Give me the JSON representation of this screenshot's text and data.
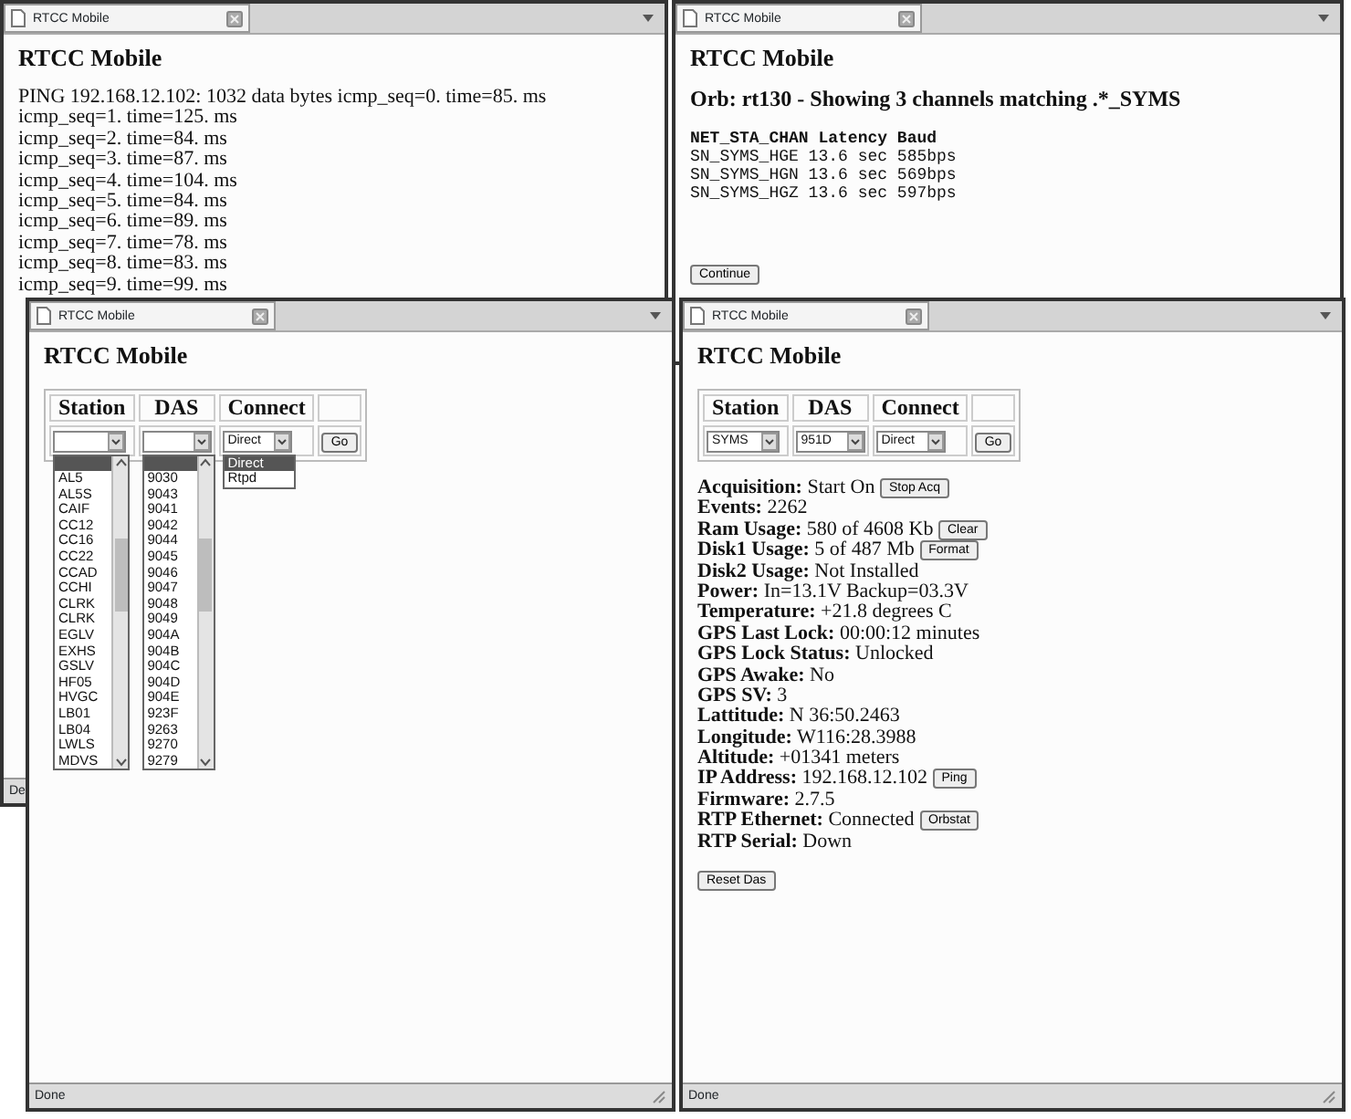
{
  "windows": [
    {
      "kind": "ping",
      "tab_title": "RTCC Mobile",
      "page_title": "RTCC Mobile",
      "lines": [
        "PING 192.168.12.102: 1032 data bytes icmp_seq=0. time=85. ms",
        "icmp_seq=1. time=125. ms",
        "icmp_seq=2. time=84. ms",
        "icmp_seq=3. time=87. ms",
        "icmp_seq=4. time=104. ms",
        "icmp_seq=5. time=84. ms",
        "icmp_seq=6. time=89. ms",
        "icmp_seq=7. time=78. ms",
        "icmp_seq=8. time=83. ms",
        "icmp_seq=9. time=99. ms"
      ],
      "status_bar": "De"
    },
    {
      "kind": "channels",
      "tab_title": "RTCC Mobile",
      "page_title": "RTCC Mobile",
      "heading": "Orb: rt130 - Showing 3 channels matching .*_SYMS",
      "table_header": "NET_STA_CHAN Latency Baud",
      "rows": [
        "SN_SYMS_HGE 13.6 sec 585bps",
        "SN_SYMS_HGN 13.6 sec 569bps",
        "SN_SYMS_HGZ 13.6 sec 597bps"
      ],
      "button": "Continue"
    },
    {
      "kind": "form",
      "tab_title": "RTCC Mobile",
      "page_title": "RTCC Mobile",
      "selects": [
        {
          "header": "Station",
          "expanded": true,
          "options": [
            {
              "selected": true
            },
            {
              "label": "AL5",
              "selected": false
            },
            {
              "label": "AL5S",
              "selected": false
            },
            {
              "label": "CAIF",
              "selected": false
            },
            {
              "label": "CC12",
              "selected": false
            },
            {
              "label": "CC16",
              "selected": false
            },
            {
              "label": "CC22",
              "selected": false
            },
            {
              "label": "CCAD",
              "selected": false
            },
            {
              "label": "CCHI",
              "selected": false
            },
            {
              "label": "CLRK",
              "selected": false
            },
            {
              "label": "CLRK",
              "selected": false
            },
            {
              "label": "EGLV",
              "selected": false
            },
            {
              "label": "EXHS",
              "selected": false
            },
            {
              "label": "GSLV",
              "selected": false
            },
            {
              "label": "HF05",
              "selected": false
            },
            {
              "label": "HVGC",
              "selected": false
            },
            {
              "label": "LB01",
              "selected": false
            },
            {
              "label": "LB04",
              "selected": false
            },
            {
              "label": "LWLS",
              "selected": false
            },
            {
              "label": "MDVS",
              "selected": false
            }
          ]
        },
        {
          "header": "DAS",
          "expanded": true,
          "options": [
            {
              "selected": true
            },
            {
              "label": "9030",
              "selected": false
            },
            {
              "label": "9043",
              "selected": false
            },
            {
              "label": "9041",
              "selected": false
            },
            {
              "label": "9042",
              "selected": false
            },
            {
              "label": "9044",
              "selected": false
            },
            {
              "label": "9045",
              "selected": false
            },
            {
              "label": "9046",
              "selected": false
            },
            {
              "label": "9047",
              "selected": false
            },
            {
              "label": "9048",
              "selected": false
            },
            {
              "label": "9049",
              "selected": false
            },
            {
              "label": "904A",
              "selected": false
            },
            {
              "label": "904B",
              "selected": false
            },
            {
              "label": "904C",
              "selected": false
            },
            {
              "label": "904D",
              "selected": false
            },
            {
              "label": "904E",
              "selected": false
            },
            {
              "label": "923F",
              "selected": false
            },
            {
              "label": "9263",
              "selected": false
            },
            {
              "label": "9270",
              "selected": false
            },
            {
              "label": "9279",
              "selected": false
            }
          ]
        },
        {
          "header": "Connect",
          "value": "Direct",
          "expanded": true,
          "options": [
            {
              "label": "Direct",
              "selected": true
            },
            {
              "label": "Rtpd",
              "selected": false
            }
          ]
        }
      ],
      "go_button": "Go",
      "status_bar": "Done"
    },
    {
      "kind": "status",
      "tab_title": "RTCC Mobile",
      "page_title": "RTCC Mobile",
      "selects": [
        {
          "header": "Station",
          "value": "SYMS"
        },
        {
          "header": "DAS",
          "value": "951D"
        },
        {
          "header": "Connect",
          "value": "Direct"
        }
      ],
      "go_button": "Go",
      "fields": [
        {
          "label": "Acquisition:",
          "value": "Start On",
          "button": "Stop Acq"
        },
        {
          "label": "Events:",
          "value": "2262"
        },
        {
          "label": "Ram Usage:",
          "value": "580 of 4608 Kb",
          "button": "Clear"
        },
        {
          "label": "Disk1 Usage:",
          "value": "5 of 487 Mb",
          "button": "Format"
        },
        {
          "label": "Disk2 Usage:",
          "value": "Not Installed"
        },
        {
          "label": "Power:",
          "value": "In=13.1V Backup=03.3V"
        },
        {
          "label": "Temperature:",
          "value": "+21.8 degrees C"
        },
        {
          "label": "GPS Last Lock:",
          "value": "00:00:12 minutes"
        },
        {
          "label": "GPS Lock Status:",
          "value": "Unlocked"
        },
        {
          "label": "GPS Awake:",
          "value": "No"
        },
        {
          "label": "GPS SV:",
          "value": "3"
        },
        {
          "label": "Lattitude:",
          "value": "N 36:50.2463"
        },
        {
          "label": "Longitude:",
          "value": "W116:28.3988"
        },
        {
          "label": "Altitude:",
          "value": "+01341 meters"
        },
        {
          "label": "IP Address:",
          "value": "192.168.12.102",
          "button": "Ping"
        },
        {
          "label": "Firmware:",
          "value": "2.7.5"
        },
        {
          "label": "RTP Ethernet:",
          "value": "Connected",
          "button": "Orbstat"
        },
        {
          "label": "RTP Serial:",
          "value": "Down"
        }
      ],
      "reset_button": "Reset Das",
      "status_bar": "Done"
    }
  ]
}
